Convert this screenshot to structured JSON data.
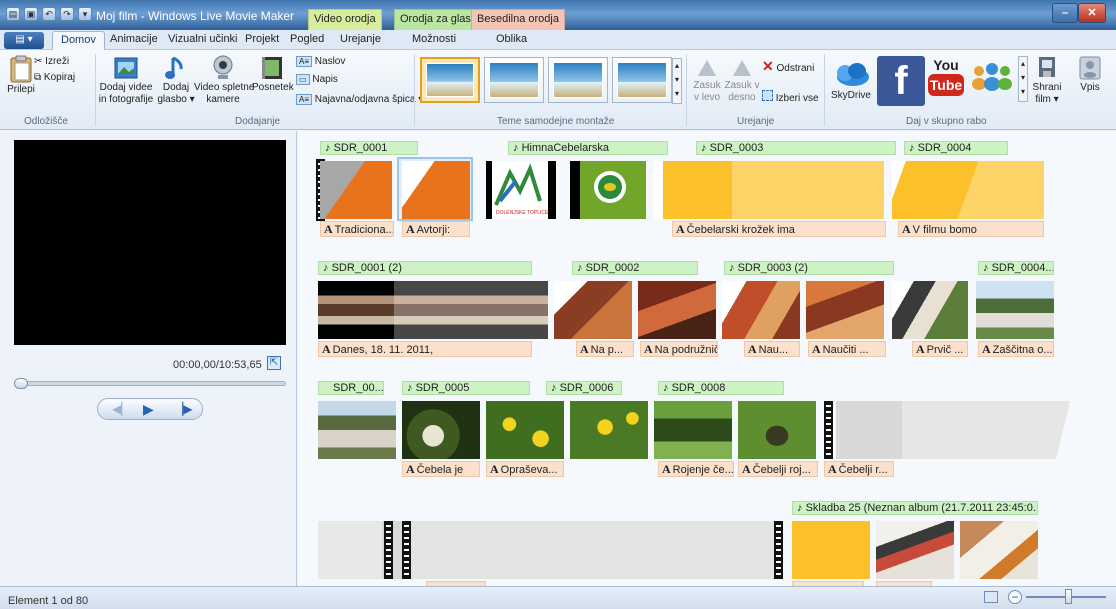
{
  "window": {
    "title": "Moj film - Windows Live Movie Maker",
    "contextual_tabs": [
      "Video orodja",
      "Orodja za glasbo",
      "Besedilna orodja"
    ]
  },
  "tabs": [
    "Domov",
    "Animacije",
    "Vizualni učinki",
    "Projekt",
    "Pogled",
    "Urejanje",
    "Možnosti",
    "Oblika"
  ],
  "active_tab": "Domov",
  "ribbon": {
    "clipboard": {
      "paste": "Prilepi",
      "cut": "Izreži",
      "copy": "Kopiraj",
      "group": "Odložišče"
    },
    "add": {
      "add_videos_1": "Dodaj videe",
      "add_videos_2": "in fotografije",
      "add_music_1": "Dodaj",
      "add_music_2": "glasbo ▾",
      "webcam_1": "Video spletne",
      "webcam_2": "kamere",
      "snapshot": "Posnetek",
      "title": "Naslov",
      "caption": "Napis",
      "credits": "Najavna/odjavna špica ▾",
      "group": "Dodajanje"
    },
    "themes": {
      "group": "Teme samodejne montaže"
    },
    "editing": {
      "rotate_left_1": "Zasuk",
      "rotate_left_2": "v levo",
      "rotate_right_1": "Zasuk v",
      "rotate_right_2": "desno",
      "remove": "Odstrani",
      "select_all": "Izberi vse",
      "group": "Urejanje"
    },
    "share": {
      "skydrive": "SkyDrive",
      "youtube_1": "You",
      "youtube_2": "Tube",
      "save_1": "Shrani",
      "save_2": "film ▾",
      "signin": "Vpis",
      "group": "Daj v skupno rabo"
    }
  },
  "preview": {
    "timecode": "00:00,00/10:53,65",
    "progress": 0.0
  },
  "storyboard": {
    "row1": {
      "audio": [
        "SDR_0001",
        "HimnaCebelarska",
        "SDR_0003",
        "SDR_0004"
      ],
      "captions": [
        "Tradiciona...",
        "Avtorji:",
        "Čebelarski krožek ima",
        "V filmu bomo"
      ]
    },
    "row2": {
      "audio": [
        "SDR_0001 (2)",
        "SDR_0002",
        "SDR_0003 (2)",
        "SDR_0004..."
      ],
      "captions": [
        "Danes, 18. 11. 2011,",
        "Na p...",
        "Na podružnič...",
        "Nau...",
        "Naučiti ...",
        "Prvič ...",
        "Zaščitna o..."
      ]
    },
    "row3": {
      "audio": [
        "SDR_00...",
        "SDR_0005",
        "SDR_0006",
        "SDR_0008"
      ],
      "captions": [
        "Čebela je",
        "Opraševa...",
        "Rojenje če...",
        "Čebelji roj...",
        "Čebelji r..."
      ]
    },
    "row4": {
      "audio": [
        "Skladba 25 (Neznan album (21.7.2011 23:45:0..."
      ]
    },
    "logo_text": "DOLENJSKE TOPLICE"
  },
  "status": {
    "text": "Element 1 od 80",
    "zoom_level": 0.55
  },
  "colors": {
    "accent": "#2f5f97",
    "audio_bar": "#cdf2c3",
    "caption_bar": "#fbe0cc",
    "orange": "#e8731c",
    "yellow": "#fcc12a"
  }
}
